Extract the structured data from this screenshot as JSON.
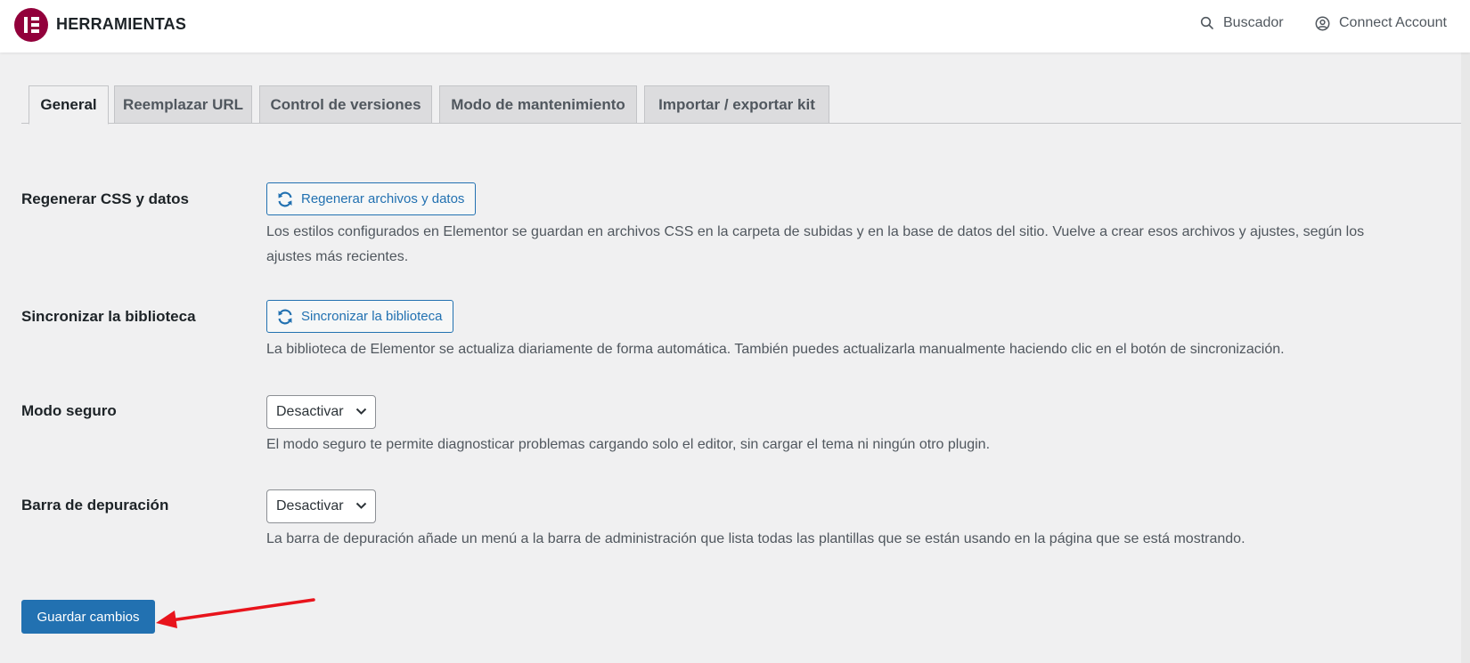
{
  "header": {
    "title": "HERRAMIENTAS",
    "search_label": "Buscador",
    "account_label": "Connect Account",
    "brand_color": "#92003b"
  },
  "tabs": [
    {
      "label": "General",
      "active": true
    },
    {
      "label": "Reemplazar URL",
      "active": false
    },
    {
      "label": "Control de versiones",
      "active": false
    },
    {
      "label": "Modo de mantenimiento",
      "active": false
    },
    {
      "label": "Importar / exportar kit",
      "active": false
    }
  ],
  "settings": {
    "regenerate": {
      "label": "Regenerar CSS y datos",
      "button": "Regenerar archivos y datos",
      "description_line1": "Los estilos configurados en Elementor se guardan en archivos CSS en la carpeta de subidas y en la base de datos del sitio. Vuelve a crear esos archivos y ajustes, según los",
      "description_line2": "ajustes más recientes."
    },
    "sync": {
      "label": "Sincronizar la biblioteca",
      "button": "Sincronizar la biblioteca",
      "description": "La biblioteca de Elementor se actualiza diariamente de forma automática. También puedes actualizarla manualmente haciendo clic en el botón de sincronización."
    },
    "safe_mode": {
      "label": "Modo seguro",
      "value": "Desactivar",
      "description": "El modo seguro te permite diagnosticar problemas cargando solo el editor, sin cargar el tema ni ningún otro plugin."
    },
    "debug_bar": {
      "label": "Barra de depuración",
      "value": "Desactivar",
      "description": "La barra de depuración añade un menú a la barra de administración que lista todas las plantillas que se están usando en la página que se está mostrando."
    }
  },
  "save_button": "Guardar cambios",
  "colors": {
    "primary": "#2271b1",
    "annotation": "#e8141c"
  },
  "icons": {
    "logo": "elementor-logo",
    "search": "search-icon",
    "account": "user-circle-icon",
    "refresh": "refresh-icon",
    "dropdown": "chevron-down-icon"
  }
}
